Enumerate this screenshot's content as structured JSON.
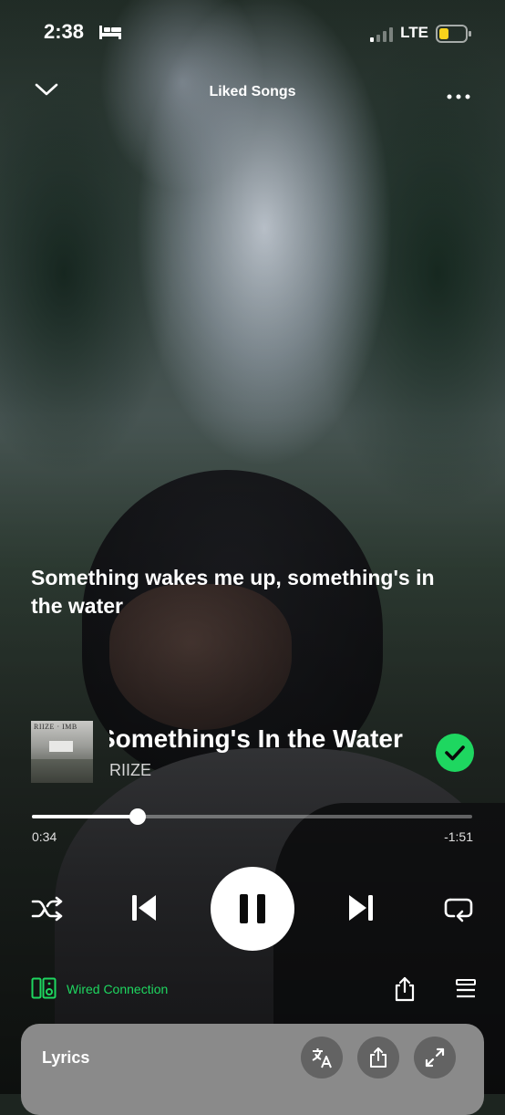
{
  "status_bar": {
    "time": "2:38",
    "network": "LTE"
  },
  "header": {
    "context_title": "Liked Songs"
  },
  "lyric": {
    "current_line": "Something wakes me up, something's in the water"
  },
  "track": {
    "title": "Something's In the Water",
    "artist": "RIIZE",
    "album_art_text": "RIIZE  ·  IMB",
    "liked": true
  },
  "progress": {
    "elapsed": "0:34",
    "remaining": "-1:51",
    "fraction": 0.24
  },
  "device": {
    "label": "Wired Connection"
  },
  "lyrics_card": {
    "title": "Lyrics"
  },
  "colors": {
    "accent": "#1ed760",
    "card": "#8a8a8a"
  },
  "icons": [
    "bed-icon",
    "signal-icon",
    "battery-icon",
    "chevron-down-icon",
    "more-icon",
    "check-icon",
    "shuffle-icon",
    "previous-icon",
    "pause-icon",
    "next-icon",
    "repeat-icon",
    "speaker-icon",
    "share-icon",
    "queue-icon",
    "translate-icon",
    "expand-icon"
  ]
}
